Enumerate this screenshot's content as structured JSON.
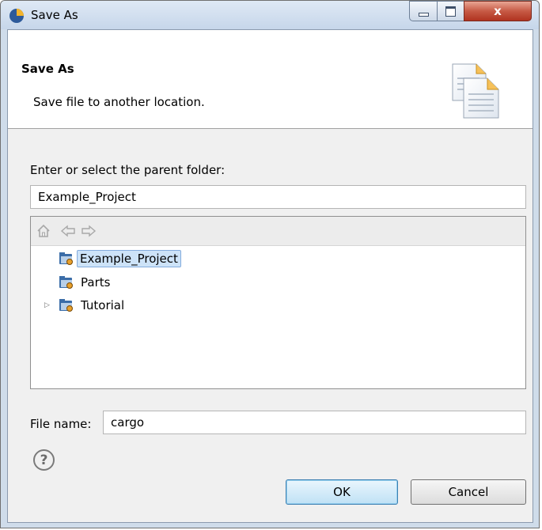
{
  "window": {
    "title": "Save As",
    "icon": "eclipse-app-icon",
    "controls": {
      "close_glyph": "x"
    }
  },
  "header": {
    "title": "Save As",
    "description": "Save file to another location.",
    "icon": "save-as-documents-icon"
  },
  "parent_folder": {
    "label": "Enter or select the parent folder:",
    "value": "Example_Project"
  },
  "tree": {
    "toolbar_icons": [
      "home-icon",
      "back-arrow-icon",
      "forward-arrow-icon"
    ],
    "items": [
      {
        "label": "Example_Project",
        "selected": true,
        "expandable": false,
        "icon": "project-folder-icon"
      },
      {
        "label": "Parts",
        "selected": false,
        "expandable": false,
        "icon": "project-folder-icon"
      },
      {
        "label": "Tutorial",
        "selected": false,
        "expandable": true,
        "icon": "project-folder-icon"
      }
    ]
  },
  "file_name": {
    "label": "File name:",
    "value": "cargo"
  },
  "buttons": {
    "help_glyph": "?",
    "ok": "OK",
    "cancel": "Cancel"
  },
  "colors": {
    "selection_fill": "#cde3f8",
    "selection_border": "#84acdd",
    "close_button": "#c75a45",
    "folder_blue": "#3b6da8"
  }
}
